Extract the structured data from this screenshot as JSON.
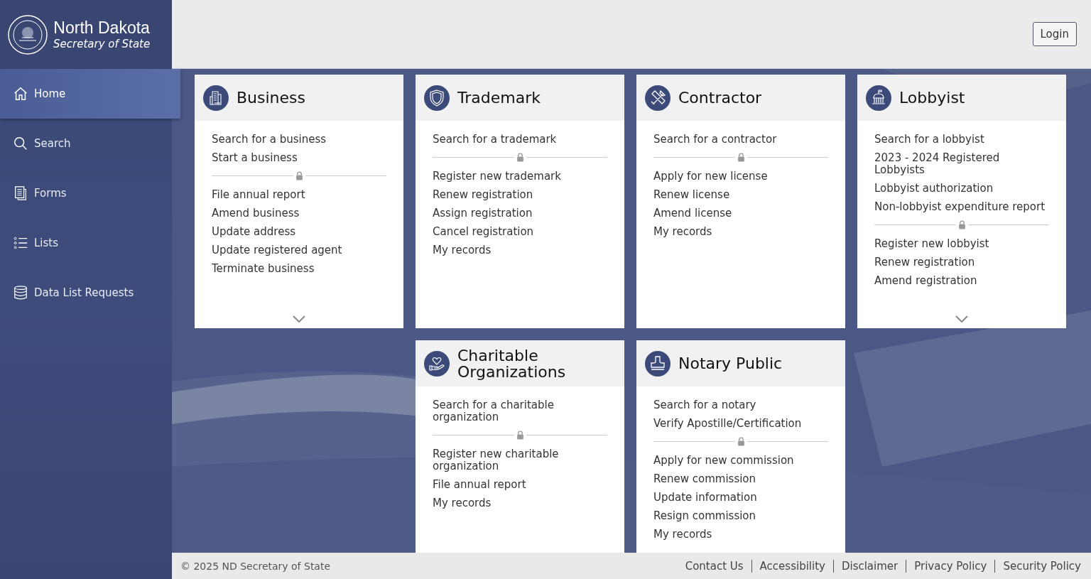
{
  "brand": {
    "title": "North Dakota",
    "subtitle": "Secretary of State"
  },
  "login": {
    "label": "Login"
  },
  "sidebar": {
    "items": [
      {
        "label": "Home",
        "kind": "home",
        "selected": true
      },
      {
        "label": "Search",
        "kind": "search",
        "selected": false
      },
      {
        "label": "Forms",
        "kind": "forms",
        "selected": false
      },
      {
        "label": "Lists",
        "kind": "lists",
        "selected": false
      },
      {
        "label": "Data List Requests",
        "kind": "database",
        "selected": false
      }
    ]
  },
  "cards": [
    {
      "title": "Business",
      "kind": "building",
      "public_links": [
        "Search for a business",
        "Start a business"
      ],
      "secure_links": [
        "File annual report",
        "Amend business",
        "Update address",
        "Update registered agent",
        "Terminate business"
      ],
      "more": true
    },
    {
      "title": "Trademark",
      "kind": "shield",
      "public_links": [
        "Search for a trademark"
      ],
      "secure_links": [
        "Register new trademark",
        "Renew registration",
        "Assign registration",
        "Cancel registration",
        "My records"
      ],
      "more": false
    },
    {
      "title": "Contractor",
      "kind": "tools",
      "public_links": [
        "Search for a contractor"
      ],
      "secure_links": [
        "Apply for new license",
        "Renew license",
        "Amend license",
        "My records"
      ],
      "more": false
    },
    {
      "title": "Lobbyist",
      "kind": "capitol",
      "public_links": [
        "Search for a lobbyist",
        "2023 - 2024 Registered Lobbyists",
        "Lobbyist authorization",
        "Non-lobbyist expenditure report"
      ],
      "secure_links": [
        "Register new lobbyist",
        "Renew registration",
        "Amend registration"
      ],
      "more": true
    },
    {
      "title": "Charitable Organizations",
      "kind": "heart-hand",
      "public_links": [
        "Search for a charitable organization"
      ],
      "secure_links": [
        "Register new charitable organization",
        "File annual report",
        "My records"
      ],
      "more": false
    },
    {
      "title": "Notary Public",
      "kind": "stamp",
      "public_links": [
        "Search for a notary",
        "Verify Apostille/Certification"
      ],
      "secure_links": [
        "Apply for new commission",
        "Renew commission",
        "Update information",
        "Resign commission",
        "My records"
      ],
      "more": false
    }
  ],
  "footer": {
    "copyright": "© 2025 ND Secretary of State",
    "links": [
      "Contact Us",
      "Accessibility",
      "Disclaimer",
      "Privacy Policy",
      "Security Policy"
    ]
  }
}
